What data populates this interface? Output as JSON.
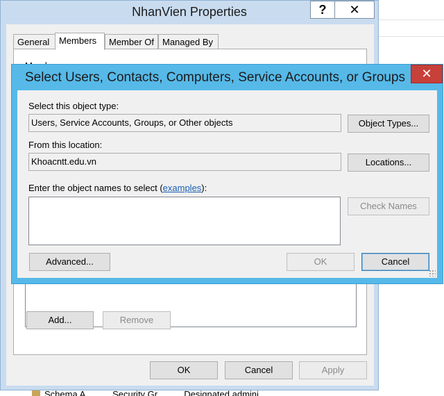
{
  "background_window": {
    "bottom_row": [
      "Schema A...",
      "Security Gr...",
      "Designated admini..."
    ]
  },
  "properties_window": {
    "title": "NhanVien Properties",
    "help_glyph": "?",
    "close_glyph": "✕",
    "tabs": [
      {
        "label": "General"
      },
      {
        "label": "Members"
      },
      {
        "label": "Member Of"
      },
      {
        "label": "Managed By"
      }
    ],
    "active_tab": "Members",
    "members_label": "Members:",
    "add_button": "Add...",
    "remove_button": "Remove",
    "ok_button": "OK",
    "cancel_button": "Cancel",
    "apply_button": "Apply"
  },
  "select_dialog": {
    "title": "Select Users, Contacts, Computers, Service Accounts, or Groups",
    "close_glyph": "✕",
    "object_type_label": "Select this object type:",
    "object_type_value": "Users, Service Accounts, Groups, or Other objects",
    "object_types_button": "Object Types...",
    "location_label": "From this location:",
    "location_value": "Khoacntt.edu.vn",
    "locations_button": "Locations...",
    "names_label_prefix": "Enter the object names to select (",
    "names_label_link": "examples",
    "names_label_suffix": "):",
    "names_value": "",
    "check_names_button": "Check Names",
    "advanced_button": "Advanced...",
    "ok_button": "OK",
    "cancel_button": "Cancel"
  },
  "colors": {
    "dialog_frame": "#56b9e8",
    "properties_frame": "#c9dcef",
    "close_red": "#c7403a",
    "link_blue": "#1a5fb4"
  }
}
